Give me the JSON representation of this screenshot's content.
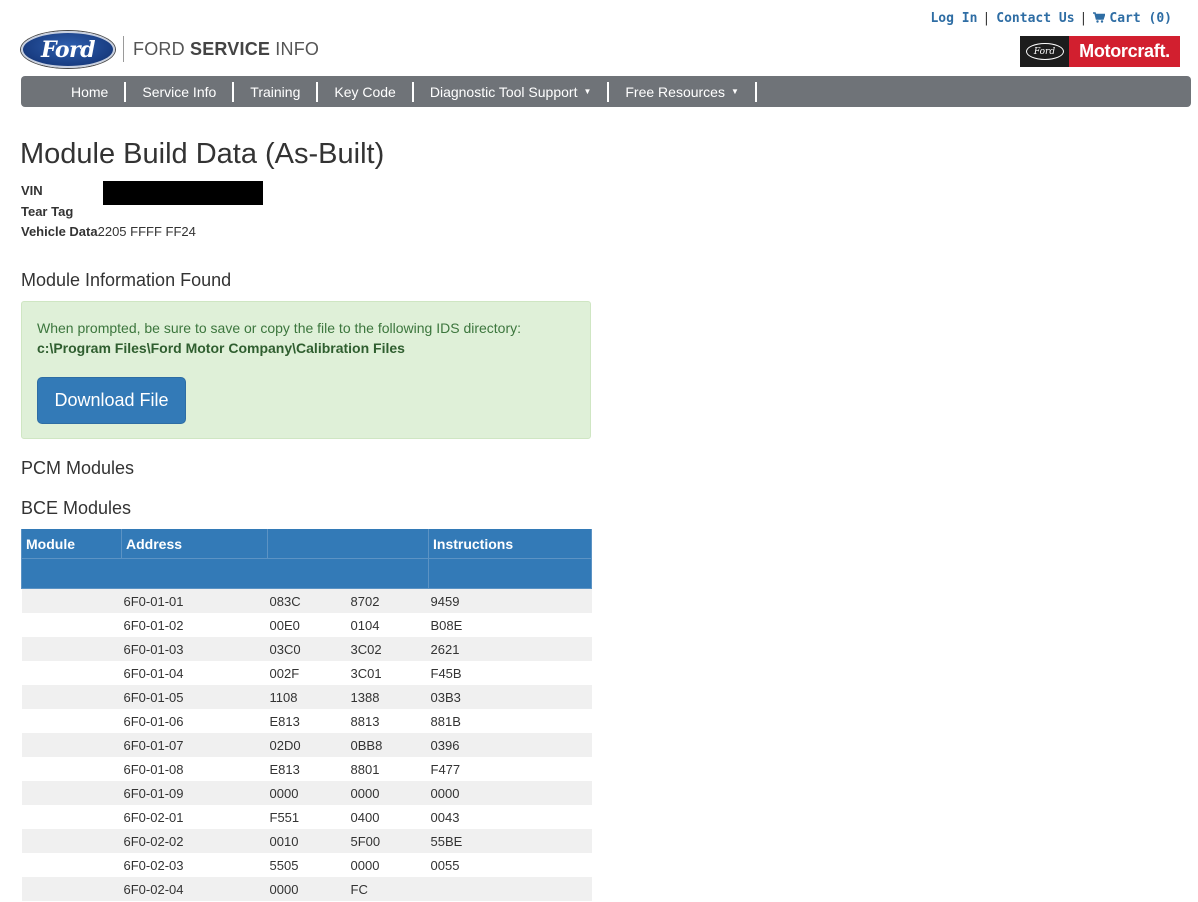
{
  "toplinks": {
    "login": "Log In",
    "sep": "|",
    "contact": "Contact Us",
    "cart": "Cart (0)"
  },
  "brand": {
    "oval_text": "Ford",
    "name_light": "FORD ",
    "name_bold": "SERVICE",
    "name_end": " INFO"
  },
  "motorcraft": {
    "ford_mini": "Ford",
    "label": "Motorcraft."
  },
  "nav": [
    {
      "label": "Home",
      "dropdown": false
    },
    {
      "label": "Service Info",
      "dropdown": false
    },
    {
      "label": "Training",
      "dropdown": false
    },
    {
      "label": "Key Code",
      "dropdown": false
    },
    {
      "label": "Diagnostic Tool Support",
      "dropdown": true
    },
    {
      "label": "Free Resources",
      "dropdown": true
    }
  ],
  "caret": "▼",
  "page": {
    "title": "Module Build Data (As-Built)",
    "vin_label": "VIN",
    "tear_tag_label": "Tear Tag",
    "vehicle_data_label": "Vehicle Data",
    "vehicle_data_value": "2205 FFFF FF24"
  },
  "module_info": {
    "heading": "Module Information Found",
    "message": "When prompted, be sure to save or copy the file to the following IDS directory:",
    "path": "c:\\Program Files\\Ford Motor Company\\Calibration Files",
    "button": "Download File"
  },
  "pcm_heading": "PCM Modules",
  "bce_heading": "BCE Modules",
  "table": {
    "headers": {
      "module": "Module",
      "address": "Address",
      "instructions": "Instructions"
    },
    "rows": [
      [
        "",
        "6F0-01-01",
        "083C",
        "8702",
        "9459"
      ],
      [
        "",
        "6F0-01-02",
        "00E0",
        "0104",
        "B08E"
      ],
      [
        "",
        "6F0-01-03",
        "03C0",
        "3C02",
        "2621"
      ],
      [
        "",
        "6F0-01-04",
        "002F",
        "3C01",
        "F45B"
      ],
      [
        "",
        "6F0-01-05",
        "1108",
        "1388",
        "03B3"
      ],
      [
        "",
        "6F0-01-06",
        "E813",
        "8813",
        "881B"
      ],
      [
        "",
        "6F0-01-07",
        "02D0",
        "0BB8",
        "0396"
      ],
      [
        "",
        "6F0-01-08",
        "E813",
        "8801",
        "F477"
      ],
      [
        "",
        "6F0-01-09",
        "0000",
        "0000",
        "0000"
      ],
      [
        "",
        "6F0-02-01",
        "F551",
        "0400",
        "0043"
      ],
      [
        "",
        "6F0-02-02",
        "0010",
        "5F00",
        "55BE"
      ],
      [
        "",
        "6F0-02-03",
        "5505",
        "0000",
        "0055"
      ],
      [
        "",
        "6F0-02-04",
        "0000",
        "FC",
        ""
      ]
    ]
  },
  "colors": {
    "accent": "#337ab7",
    "nav_bg": "#6f7378",
    "alert_bg": "#dff0d8",
    "motorcraft_red": "#d21f2f"
  },
  "icons": {
    "cart": "shopping-cart-icon"
  }
}
